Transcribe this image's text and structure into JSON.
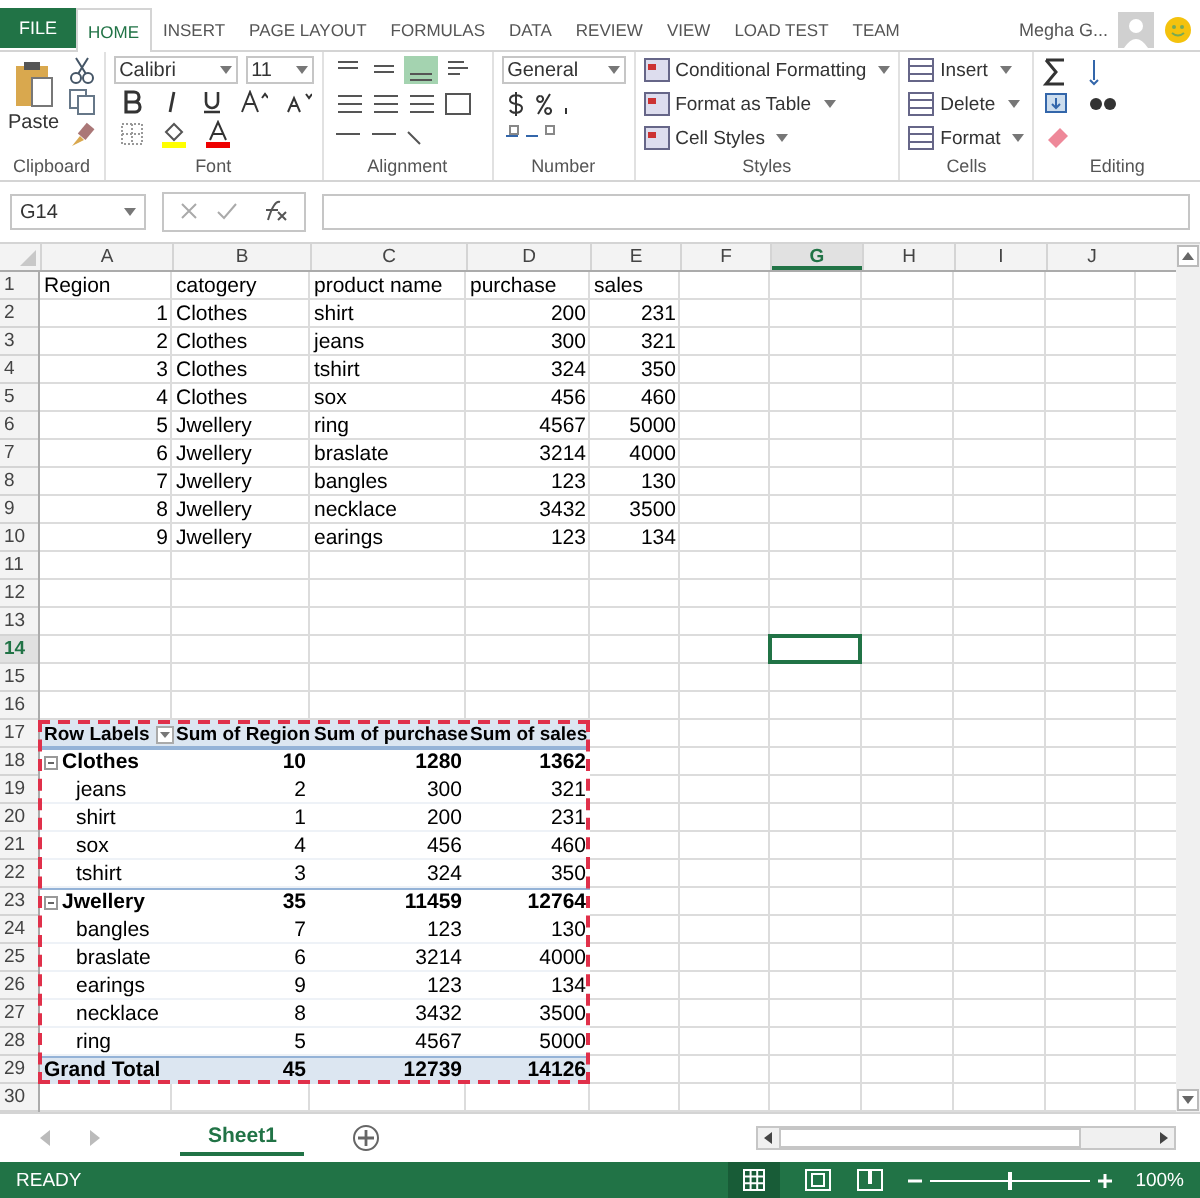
{
  "ribbon_tabs": [
    {
      "label": "FILE",
      "kind": "file",
      "selected": false
    },
    {
      "label": "HOME",
      "kind": "tab",
      "selected": true
    },
    {
      "label": "INSERT",
      "kind": "tab",
      "selected": false
    },
    {
      "label": "PAGE LAYOUT",
      "kind": "tab",
      "selected": false
    },
    {
      "label": "FORMULAS",
      "kind": "tab",
      "selected": false
    },
    {
      "label": "DATA",
      "kind": "tab",
      "selected": false
    },
    {
      "label": "REVIEW",
      "kind": "tab",
      "selected": false
    },
    {
      "label": "VIEW",
      "kind": "tab",
      "selected": false
    },
    {
      "label": "LOAD TEST",
      "kind": "tab",
      "selected": false
    },
    {
      "label": "TEAM",
      "kind": "tab",
      "selected": false
    }
  ],
  "user": "Megha G...",
  "ribbon": {
    "paste": "Paste",
    "font_name": "Calibri",
    "font_size": "11",
    "number_format": "General",
    "styles": [
      "Conditional Formatting",
      "Format as Table",
      "Cell Styles"
    ],
    "cells": [
      "Insert",
      "Delete",
      "Format"
    ],
    "groups": [
      "Clipboard",
      "Font",
      "Alignment",
      "Number",
      "Styles",
      "Cells",
      "Editing"
    ]
  },
  "name_box": "G14",
  "columns": [
    {
      "label": "A",
      "selected": false
    },
    {
      "label": "B",
      "selected": false
    },
    {
      "label": "C",
      "selected": false
    },
    {
      "label": "D",
      "selected": false
    },
    {
      "label": "E",
      "selected": false
    },
    {
      "label": "F",
      "selected": false
    },
    {
      "label": "G",
      "selected": true
    },
    {
      "label": "H",
      "selected": false
    },
    {
      "label": "I",
      "selected": false
    },
    {
      "label": "J",
      "selected": false
    }
  ],
  "row_numbers": [
    {
      "label": "1",
      "selected": false
    },
    {
      "label": "2",
      "selected": false
    },
    {
      "label": "3",
      "selected": false
    },
    {
      "label": "4",
      "selected": false
    },
    {
      "label": "5",
      "selected": false
    },
    {
      "label": "6",
      "selected": false
    },
    {
      "label": "7",
      "selected": false
    },
    {
      "label": "8",
      "selected": false
    },
    {
      "label": "9",
      "selected": false
    },
    {
      "label": "10",
      "selected": false
    },
    {
      "label": "11",
      "selected": false
    },
    {
      "label": "12",
      "selected": false
    },
    {
      "label": "13",
      "selected": false
    },
    {
      "label": "14",
      "selected": true
    },
    {
      "label": "15",
      "selected": false
    },
    {
      "label": "16",
      "selected": false
    },
    {
      "label": "17",
      "selected": false
    },
    {
      "label": "18",
      "selected": false
    },
    {
      "label": "19",
      "selected": false
    },
    {
      "label": "20",
      "selected": false
    },
    {
      "label": "21",
      "selected": false
    },
    {
      "label": "22",
      "selected": false
    },
    {
      "label": "23",
      "selected": false
    },
    {
      "label": "24",
      "selected": false
    },
    {
      "label": "25",
      "selected": false
    },
    {
      "label": "26",
      "selected": false
    },
    {
      "label": "27",
      "selected": false
    },
    {
      "label": "28",
      "selected": false
    },
    {
      "label": "29",
      "selected": false
    },
    {
      "label": "30",
      "selected": false
    }
  ],
  "sheet_rows": [
    {
      "kind": "header",
      "cells": [
        "Region",
        "catogery",
        "product name",
        "purchase",
        "sales"
      ]
    },
    {
      "kind": "data",
      "cells": [
        "1",
        "Clothes",
        "shirt",
        "200",
        "231"
      ]
    },
    {
      "kind": "data",
      "cells": [
        "2",
        "Clothes",
        "jeans",
        "300",
        "321"
      ]
    },
    {
      "kind": "data",
      "cells": [
        "3",
        "Clothes",
        "tshirt",
        "324",
        "350"
      ]
    },
    {
      "kind": "data",
      "cells": [
        "4",
        "Clothes",
        "sox",
        "456",
        "460"
      ]
    },
    {
      "kind": "data",
      "cells": [
        "5",
        "Jwellery",
        "ring",
        "4567",
        "5000"
      ]
    },
    {
      "kind": "data",
      "cells": [
        "6",
        "Jwellery",
        "braslate",
        "3214",
        "4000"
      ]
    },
    {
      "kind": "data",
      "cells": [
        "7",
        "Jwellery",
        "bangles",
        "123",
        "130"
      ]
    },
    {
      "kind": "data",
      "cells": [
        "8",
        "Jwellery",
        "necklace",
        "3432",
        "3500"
      ]
    },
    {
      "kind": "data",
      "cells": [
        "9",
        "Jwellery",
        "earings",
        "123",
        "134"
      ]
    }
  ],
  "pivot": {
    "header": [
      "Row Labels",
      "Sum of Region",
      "Sum of purchase",
      "Sum of sales"
    ],
    "groups": [
      {
        "label": "Clothes",
        "values": [
          "10",
          "1280",
          "1362"
        ],
        "expanded": true,
        "children": [
          {
            "label": "jeans",
            "values": [
              "2",
              "300",
              "321"
            ]
          },
          {
            "label": "shirt",
            "values": [
              "1",
              "200",
              "231"
            ]
          },
          {
            "label": "sox",
            "values": [
              "4",
              "456",
              "460"
            ]
          },
          {
            "label": "tshirt",
            "values": [
              "3",
              "324",
              "350"
            ]
          }
        ]
      },
      {
        "label": "Jwellery",
        "values": [
          "35",
          "11459",
          "12764"
        ],
        "expanded": true,
        "children": [
          {
            "label": "bangles",
            "values": [
              "7",
              "123",
              "130"
            ]
          },
          {
            "label": "braslate",
            "values": [
              "6",
              "3214",
              "4000"
            ]
          },
          {
            "label": "earings",
            "values": [
              "9",
              "123",
              "134"
            ]
          },
          {
            "label": "necklace",
            "values": [
              "8",
              "3432",
              "3500"
            ]
          },
          {
            "label": "ring",
            "values": [
              "5",
              "4567",
              "5000"
            ]
          }
        ]
      }
    ],
    "total": {
      "label": "Grand Total",
      "values": [
        "45",
        "12739",
        "14126"
      ]
    }
  },
  "sheet_tabs": [
    {
      "label": "Sheet1",
      "selected": true
    }
  ],
  "status": "READY",
  "zoom_slider": {
    "level": 0.5
  },
  "zoom": "100%"
}
